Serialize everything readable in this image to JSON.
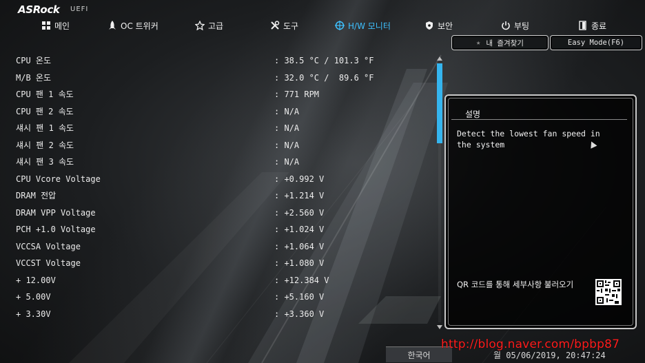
{
  "header": {
    "brand": "ASRock",
    "brand_sub": "UEFI"
  },
  "nav": [
    {
      "label": "메인",
      "icon": "grid-icon",
      "active": false
    },
    {
      "label": "OC 트위커",
      "icon": "rocket-icon",
      "active": false
    },
    {
      "label": "고급",
      "icon": "star-icon",
      "active": false
    },
    {
      "label": "도구",
      "icon": "tools-icon",
      "active": false
    },
    {
      "label": "H/W 모니터",
      "icon": "crosshair-icon",
      "active": true
    },
    {
      "label": "보안",
      "icon": "shield-icon",
      "active": false
    },
    {
      "label": "부팅",
      "icon": "power-icon",
      "active": false
    },
    {
      "label": "종료",
      "icon": "exit-icon",
      "active": false
    }
  ],
  "buttons": {
    "favorites": "내 즐겨찾기",
    "easy_mode": "Easy Mode(F6)"
  },
  "monitor_rows": [
    {
      "label": "CPU 온도",
      "value": ": 38.5 °C / 101.3 °F"
    },
    {
      "label": "M/B 온도",
      "value": ": 32.0 °C /  89.6 °F"
    },
    {
      "label": "CPU 팬 1 속도",
      "value": ": 771 RPM"
    },
    {
      "label": "CPU 팬 2 속도",
      "value": ": N/A"
    },
    {
      "label": "섀시 팬 1 속도",
      "value": ": N/A"
    },
    {
      "label": "섀시 팬 2 속도",
      "value": ": N/A"
    },
    {
      "label": "섀시 팬 3 속도",
      "value": ": N/A"
    },
    {
      "label": "CPU Vcore Voltage",
      "value": ": +0.992 V"
    },
    {
      "label": "DRAM 전압",
      "value": ": +1.214 V"
    },
    {
      "label": "DRAM VPP Voltage",
      "value": ": +2.560 V"
    },
    {
      "label": "PCH +1.0 Voltage",
      "value": ": +1.024 V"
    },
    {
      "label": "VCCSA Voltage",
      "value": ": +1.064 V"
    },
    {
      "label": "VCCST Voltage",
      "value": ": +1.080 V"
    },
    {
      "label": "+ 12.00V",
      "value": ": +12.384 V"
    },
    {
      "label": "+ 5.00V",
      "value": ": +5.160 V"
    },
    {
      "label": "+ 3.30V",
      "value": ": +3.360 V"
    }
  ],
  "description_panel": {
    "title": "설명",
    "text": "Detect the lowest fan speed in the system",
    "qr_text": "QR 코드를 통해 세부사항 불러오기"
  },
  "footer": {
    "language": "한국어",
    "datetime": "월 05/06/2019, 20:47:24",
    "watermark": "http://blog.naver.com/bpbp87"
  },
  "colors": {
    "accent": "#3ec1ff",
    "scroll_thumb": "#35b5ef",
    "watermark": "#ff1d1d"
  }
}
